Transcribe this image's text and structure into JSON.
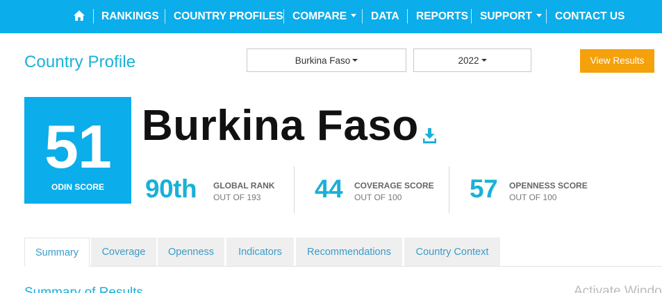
{
  "nav": {
    "home_icon": "home-icon",
    "items": [
      {
        "label": "RANKINGS",
        "dropdown": false
      },
      {
        "label": "COUNTRY PROFILES",
        "dropdown": false
      },
      {
        "label": "COMPARE",
        "dropdown": true
      },
      {
        "label": "DATA",
        "dropdown": false
      },
      {
        "label": "REPORTS",
        "dropdown": false
      },
      {
        "label": "SUPPORT",
        "dropdown": true
      },
      {
        "label": "CONTACT US",
        "dropdown": false
      }
    ]
  },
  "header": {
    "title": "Country Profile",
    "country_select": "Burkina Faso",
    "year_select": "2022",
    "view_button": "View Results"
  },
  "profile": {
    "odin_score": "51",
    "odin_label": "ODIN SCORE",
    "country": "Burkina Faso",
    "download_icon": "download-icon",
    "stats": [
      {
        "value": "90th",
        "title": "GLOBAL RANK",
        "sub": "OUT OF 193"
      },
      {
        "value": "44",
        "title": "COVERAGE SCORE",
        "sub": "OUT OF 100"
      },
      {
        "value": "57",
        "title": "OPENNESS SCORE",
        "sub": "OUT OF 100"
      }
    ]
  },
  "tabs": [
    {
      "label": "Summary",
      "active": true
    },
    {
      "label": "Coverage",
      "active": false
    },
    {
      "label": "Openness",
      "active": false
    },
    {
      "label": "Indicators",
      "active": false
    },
    {
      "label": "Recommendations",
      "active": false
    },
    {
      "label": "Country Context",
      "active": false
    }
  ],
  "cut_off": {
    "section_heading": "Summary of Results",
    "watermark": "Activate Windows"
  },
  "colors": {
    "brand_blue": "#0badea",
    "accent_text": "#1ab0d8",
    "button_orange": "#f5a10b"
  }
}
